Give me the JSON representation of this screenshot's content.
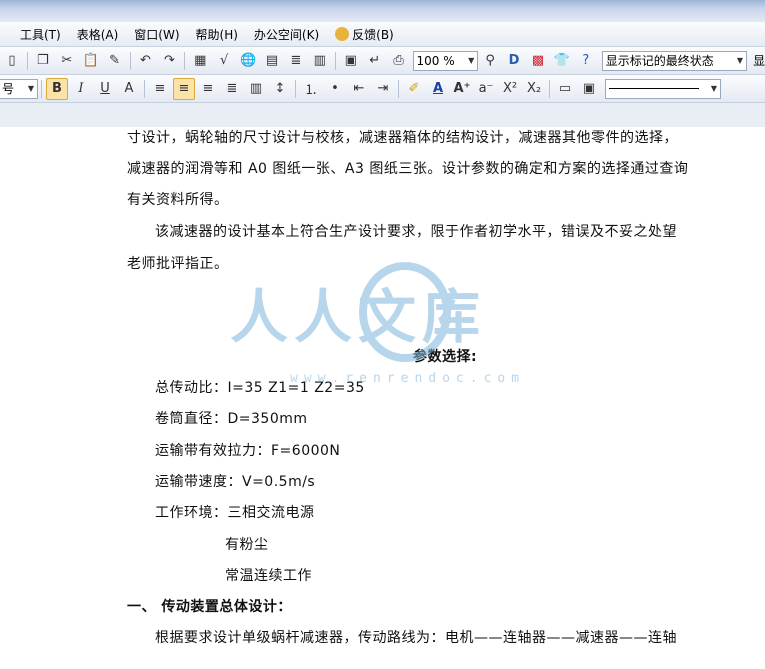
{
  "menu": {
    "items": [
      "工具(T)",
      "表格(A)",
      "窗口(W)",
      "帮助(H)",
      "办公空间(K)",
      "反馈(B)"
    ]
  },
  "toolbar": {
    "zoom": "100 %",
    "track_changes_state": "显示标记的最终状态",
    "track_changes_right_label": "显",
    "font_size_partial": "号"
  },
  "document": {
    "lines": [
      "寸设计，蜗轮轴的尺寸设计与校核，减速器箱体的结构设计，减速器其他零件的选择，",
      "减速器的润滑等和 A0 图纸一张、A3 图纸三张。设计参数的确定和方案的选择通过查询",
      "有关资料所得。",
      "该减速器的设计基本上符合生产设计要求，限于作者初学水平，错误及不妥之处望",
      "老师批评指正。"
    ],
    "heading": "参数选择:",
    "params": [
      "总传动比：I=35  Z1=1  Z2=35",
      "卷筒直径：D=350mm",
      "运输带有效拉力：F=6000N",
      "运输带速度：V=0.5m/s",
      "工作环境：三相交流电源"
    ],
    "env_extra": [
      "有粉尘",
      "常温连续工作"
    ],
    "section_title": "一、  传动装置总体设计：",
    "last_line": "根据要求设计单级蜗杆减速器，传动路线为：电机——连轴器——减速器——连轴"
  },
  "watermark": {
    "text": "人人文库",
    "url": "www.renrendoc.com",
    "color": "#7fb6dc"
  }
}
